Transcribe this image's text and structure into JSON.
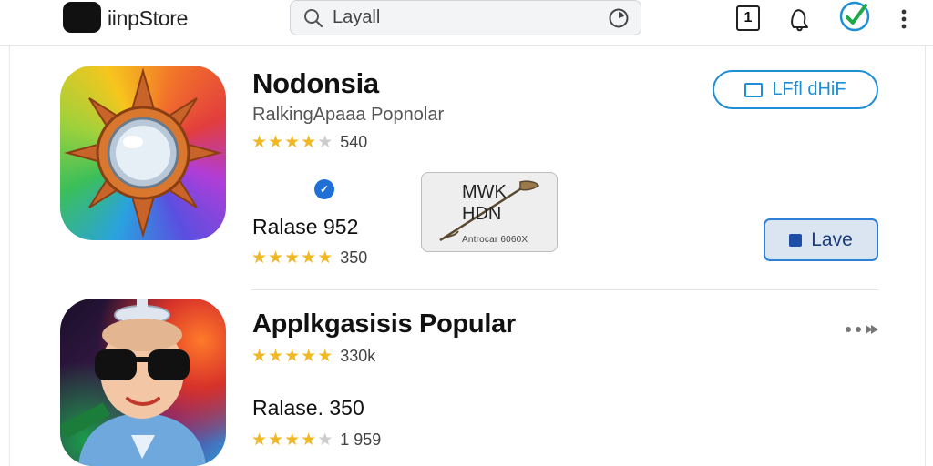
{
  "header": {
    "app_name": "iinpStore",
    "search_placeholder": "Layall",
    "badge_value": "1",
    "icons": [
      "logo-icon",
      "search-icon",
      "clock-icon",
      "badge-icon",
      "bell-icon",
      "check-circle-icon",
      "more-icon"
    ]
  },
  "apps": [
    {
      "title": "Nodonsia",
      "subtitle": "RalkingApaaa Popnolar",
      "rating_a": 4,
      "count_a": "540",
      "release": "Ralase 952",
      "rating_b": 4.5,
      "count_b": "350",
      "thumbnail": {
        "line1": "MWK",
        "line2": "HDN",
        "line3": "Antrocar 6060X"
      },
      "outline_button": "LFfl dHiF",
      "action_button": "Lave"
    },
    {
      "title": "Applkgasisis Popular",
      "rating_a": 5,
      "count_a": "330k",
      "release": "Ralase. 350",
      "rating_b": 4,
      "count_b": "1 959"
    }
  ],
  "colors": {
    "accent": "#1c8fd6",
    "star": "#f2b822",
    "check": "#1fa84a"
  }
}
